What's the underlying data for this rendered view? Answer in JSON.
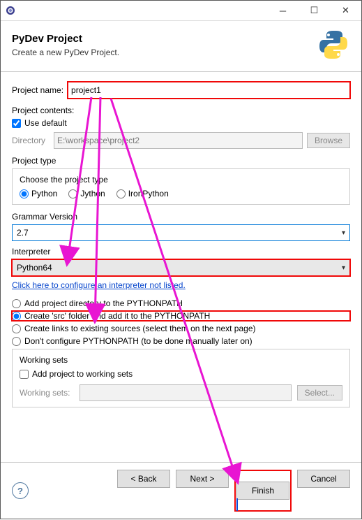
{
  "window": {
    "min_icon": "─",
    "max_icon": "☐",
    "close_icon": "✕"
  },
  "header": {
    "title": "PyDev Project",
    "subtitle": "Create a new PyDev Project."
  },
  "project_name": {
    "label": "Project name:",
    "value": "project1"
  },
  "project_contents": {
    "title": "Project contents:",
    "use_default_label": "Use default",
    "use_default_checked": true,
    "directory_label": "Directory",
    "directory_value": "E:\\workspace\\project2",
    "browse_label": "Browse"
  },
  "project_type": {
    "title": "Project type",
    "choose_label": "Choose the project type",
    "options": [
      "Python",
      "Jython",
      "IronPython"
    ],
    "selected": "Python"
  },
  "grammar": {
    "title": "Grammar Version",
    "value": "2.7"
  },
  "interpreter": {
    "title": "Interpreter",
    "value": "Python64",
    "link": "Click here to configure an interpreter not listed."
  },
  "pythonpath_options": {
    "opt1": "Add project directory to the PYTHONPATH",
    "opt2": "Create 'src' folder and add it to the PYTHONPATH",
    "opt3": "Create links to existing sources (select them on the next page)",
    "opt4": "Don't configure PYTHONPATH (to be done manually later on)",
    "selected": "opt2"
  },
  "working_sets": {
    "title": "Working sets",
    "add_label": "Add project to working sets",
    "add_checked": false,
    "list_label": "Working sets:",
    "select_label": "Select..."
  },
  "buttons": {
    "back": "< Back",
    "next": "Next >",
    "finish": "Finish",
    "cancel": "Cancel"
  },
  "help_icon": "?"
}
